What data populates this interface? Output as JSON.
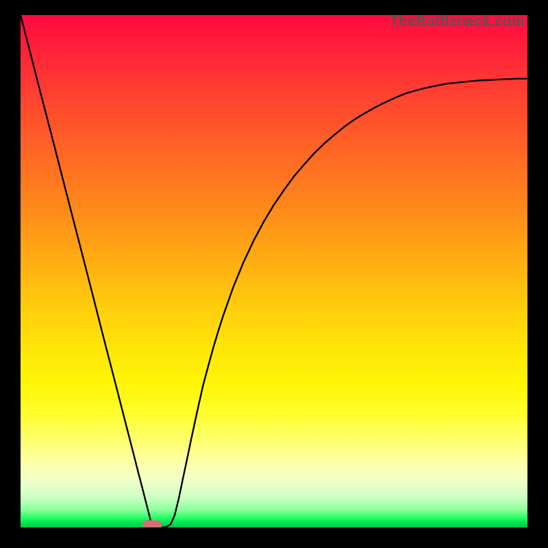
{
  "watermark": "TheBottleneck.com",
  "chart_data": {
    "type": "line",
    "title": "",
    "xlabel": "",
    "ylabel": "",
    "xlim": [
      0,
      1
    ],
    "ylim": [
      0,
      1
    ],
    "x": [
      0.0,
      0.02,
      0.04,
      0.06,
      0.08,
      0.1,
      0.122,
      0.144,
      0.166,
      0.188,
      0.21,
      0.222,
      0.232,
      0.24,
      0.248,
      0.256,
      0.264,
      0.272,
      0.28,
      0.288,
      0.296,
      0.26,
      0.304,
      0.312,
      0.32,
      0.328,
      0.336,
      0.344,
      0.352,
      0.36,
      0.37,
      0.38,
      0.39,
      0.4,
      0.42,
      0.44,
      0.46,
      0.48,
      0.5,
      0.52,
      0.54,
      0.56,
      0.58,
      0.6,
      0.62,
      0.64,
      0.66,
      0.68,
      0.7,
      0.72,
      0.74,
      0.76,
      0.78,
      0.8,
      0.82,
      0.84,
      0.86,
      0.88,
      0.9,
      0.92,
      0.94,
      0.96,
      0.98,
      1.0
    ],
    "y": [
      1.0,
      0.923,
      0.846,
      0.77,
      0.693,
      0.616,
      0.532,
      0.447,
      0.362,
      0.278,
      0.193,
      0.147,
      0.108,
      0.078,
      0.047,
      0.016,
      0.003,
      0.001,
      0.0,
      0.001,
      0.006,
      0.0,
      0.024,
      0.056,
      0.094,
      0.131,
      0.169,
      0.206,
      0.242,
      0.277,
      0.314,
      0.35,
      0.383,
      0.414,
      0.47,
      0.518,
      0.56,
      0.597,
      0.63,
      0.659,
      0.686,
      0.709,
      0.731,
      0.75,
      0.767,
      0.783,
      0.797,
      0.809,
      0.82,
      0.83,
      0.839,
      0.847,
      0.853,
      0.858,
      0.862,
      0.866,
      0.868,
      0.87,
      0.872,
      0.873,
      0.874,
      0.875,
      0.876,
      0.876
    ],
    "marker": {
      "x": 0.26,
      "y": 0.0
    },
    "gradient_stops": [
      {
        "pos": 0.0,
        "color": "#ff0b3f"
      },
      {
        "pos": 0.28,
        "color": "#ff6a24"
      },
      {
        "pos": 0.58,
        "color": "#ffd00c"
      },
      {
        "pos": 0.78,
        "color": "#fffd2e"
      },
      {
        "pos": 0.94,
        "color": "#ceffc4"
      },
      {
        "pos": 1.0,
        "color": "#00c848"
      }
    ]
  }
}
